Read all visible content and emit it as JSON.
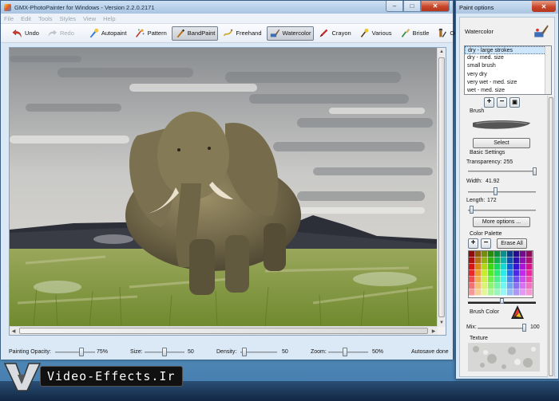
{
  "window": {
    "title": "GMX-PhotoPainter for Windows - Version 2.2.0.2171"
  },
  "menu": [
    "File",
    "Edit",
    "Tools",
    "Styles",
    "View",
    "Help"
  ],
  "toolbar": {
    "undo": "Undo",
    "redo": "Redo",
    "autopaint": "Autopaint",
    "pattern": "Pattern",
    "bandpaint": "BandPaint",
    "freehand": "Freehand",
    "watercolor": "Watercolor",
    "crayon": "Crayon",
    "various": "Various",
    "bristle": "Bristle",
    "oil": "Oil"
  },
  "status": {
    "opacity_label": "Painting Opacity:",
    "opacity_value": "75%",
    "opacity_level": 0.75,
    "size_label": "Size:",
    "size_value": "50",
    "density_label": "Density:",
    "density_value": "50",
    "zoom_label": "Zoom:",
    "zoom_value": "50%",
    "autosave": "Autosave done"
  },
  "options": {
    "title": "Paint options",
    "style_name": "Watercolor",
    "brushes": [
      "dry - large strokes",
      "dry - med. size",
      "small brush",
      "very dry",
      "very wet - med. size",
      "wet - med. size"
    ],
    "selected_brush": 0,
    "brush_label": "Brush",
    "select_button": "Select",
    "basic_settings": "Basic Settings",
    "transparency_label": "Transparency: 255",
    "width_label": "Width:",
    "width_value": "41.92",
    "length_label": "Length:",
    "length_value": "172",
    "more_options": "More options ...",
    "palette_label": "Color Palette",
    "erase_all": "Erase All",
    "brush_color_label": "Brush Color",
    "mix_label": "Mix:",
    "mix_value": "100",
    "texture_label": "Texture"
  },
  "watermark": {
    "text": "Video-Effects.Ir"
  },
  "colors": {
    "title_gradient": "#b9d1ea",
    "close_button": "#c9462a",
    "selection": "#cde6fb"
  }
}
